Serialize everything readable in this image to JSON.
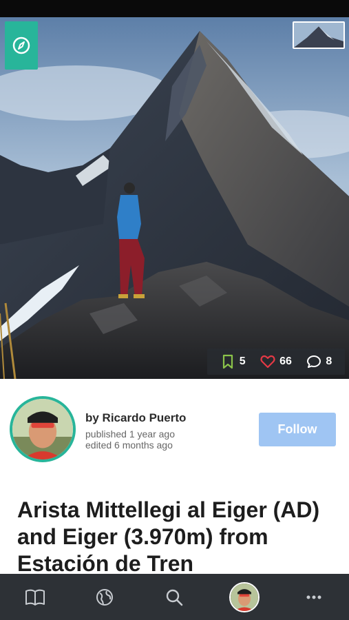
{
  "hero": {
    "stats": {
      "bookmarks": "5",
      "likes": "66",
      "comments": "8"
    }
  },
  "author": {
    "name": "by Ricardo Puerto",
    "published": "published 1 year ago",
    "edited": "edited 6 months ago",
    "follow_label": "Follow"
  },
  "article": {
    "title": "Arista Mittellegi al Eiger (AD) and Eiger (3.970m) from Estación de Tren"
  },
  "colors": {
    "accent": "#28b59a",
    "follow_button": "#9fc5f3",
    "nav_background": "#2d3136",
    "like_red": "#e53945",
    "bookmark_green": "#8bc34a"
  },
  "nav": {
    "icons": [
      "book-icon",
      "globe-icon",
      "search-icon",
      "profile-avatar",
      "more-icon"
    ]
  }
}
